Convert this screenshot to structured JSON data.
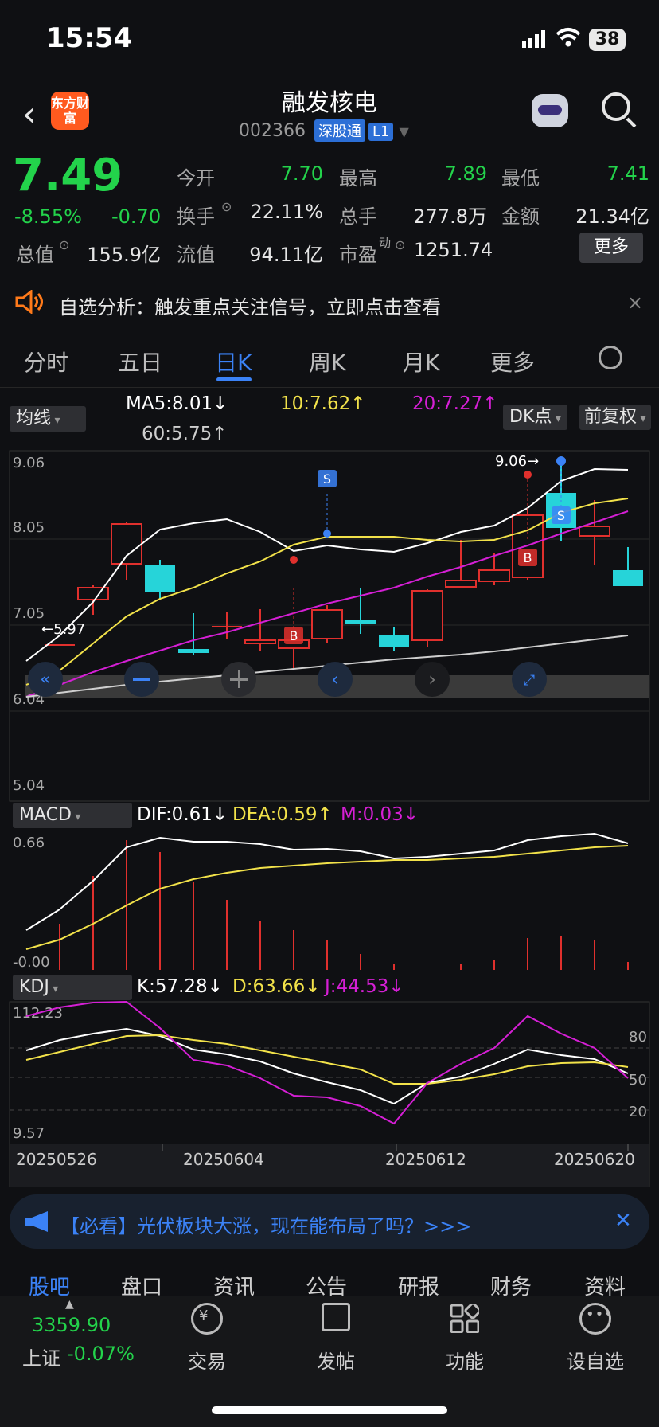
{
  "status_bar": {
    "time": "15:54",
    "battery": "38"
  },
  "header": {
    "logo_text": "东方财富",
    "stock_name": "融发核电",
    "code": "002366",
    "tag1": "深股通",
    "tag2": "L1"
  },
  "quote": {
    "price": "7.49",
    "change_pct": "-8.55%",
    "change": "-0.70",
    "open_label": "今开",
    "open": "7.70",
    "high_label": "最高",
    "high": "7.89",
    "low_label": "最低",
    "low": "7.41",
    "turnover_label": "换手",
    "turnover": "22.11%",
    "volume_label": "总手",
    "volume": "277.8万",
    "amount_label": "金额",
    "amount": "21.34亿",
    "mktcap_label": "总值",
    "mktcap": "155.9亿",
    "float_label": "流值",
    "float": "94.11亿",
    "pe_label": "市盈",
    "pe_sup": "动",
    "pe": "1251.74",
    "more": "更多"
  },
  "notice": {
    "text": "自选分析：触发重点关注信号，立即点击查看",
    "close": "×"
  },
  "tabs": [
    "分时",
    "五日",
    "日K",
    "周K",
    "月K",
    "更多"
  ],
  "ma_bar": {
    "selector": "均线",
    "ma5": "MA5:8.01↓",
    "ma10": "10:7.62↑",
    "ma20": "20:7.27↑",
    "ma60": "60:5.75↑",
    "dk_button": "DK点",
    "adjust_button": "前复权"
  },
  "main_axis": {
    "max": "9.06",
    "l2": "8.05",
    "l3": "7.05",
    "l4": "6.04",
    "min": "5.04",
    "peak_label": "9.06→",
    "low_label": "←5.97"
  },
  "macd_bar": {
    "selector": "MACD",
    "dif": "DIF:0.61↓",
    "dea": "DEA:0.59↑",
    "m": "M:0.03↓",
    "top": "0.66",
    "bottom": "-0.00"
  },
  "kdj_bar": {
    "selector": "KDJ",
    "k": "K:57.28↓",
    "d": "D:63.66↓",
    "j": "J:44.53↓",
    "top": "112.23",
    "bottom": "9.57",
    "r80": "80",
    "r50": "50",
    "r20": "20"
  },
  "dates": [
    "20250526",
    "20250604",
    "20250612",
    "20250620"
  ],
  "signals": {
    "buy": "B",
    "sell": "S"
  },
  "colors": {
    "up": "#e0302d",
    "down": "#26d4d9",
    "ma5": "#ffffff",
    "ma10": "#f2e24a",
    "ma20": "#d51fd5",
    "ma60": "#cfcfcf",
    "accent": "#3b82f6",
    "green": "#23d34b"
  },
  "ad_banner": {
    "text": "【必看】光伏板块大涨，现在能布局了吗？>>>"
  },
  "subtabs": [
    "股吧",
    "盘口",
    "资讯",
    "公告",
    "研报",
    "财务",
    "资料"
  ],
  "footer": {
    "index_value": "3359.90",
    "index_name": "上证",
    "index_chg": "-0.07%",
    "items": [
      "交易",
      "发帖",
      "功能",
      "设自选"
    ]
  }
}
